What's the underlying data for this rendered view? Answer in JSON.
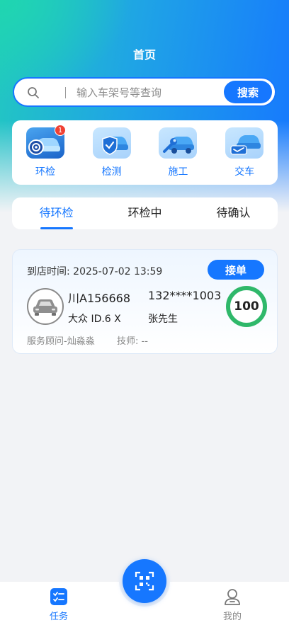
{
  "header": {
    "title": "首页"
  },
  "search": {
    "placeholder": "输入车架号等查询",
    "button_label": "搜索"
  },
  "categories": [
    {
      "label": "环检",
      "badge": "1",
      "icon": "inspection-cycle-icon"
    },
    {
      "label": "检测",
      "icon": "detection-shield-icon"
    },
    {
      "label": "施工",
      "icon": "wrench-car-icon"
    },
    {
      "label": "交车",
      "icon": "car-delivery-icon"
    }
  ],
  "tabs": [
    {
      "label": "待环检",
      "active": true
    },
    {
      "label": "环检中",
      "active": false
    },
    {
      "label": "待确认",
      "active": false
    }
  ],
  "task_card": {
    "arrival_time": "到店时间: 2025-07-02 13:59",
    "accept_label": "接单",
    "plate": "川A156668",
    "phone": "132****1003",
    "model": "大众 ID.6 X",
    "owner": "张先生",
    "score": "100",
    "advisor": "服务顾问-灿淼淼",
    "technician": "技师: --"
  },
  "bottom_nav": {
    "tasks_label": "任务",
    "mine_label": "我的"
  },
  "colors": {
    "accent": "#1677ff",
    "score_ring": "#2fb86a",
    "badge": "#f04134"
  }
}
